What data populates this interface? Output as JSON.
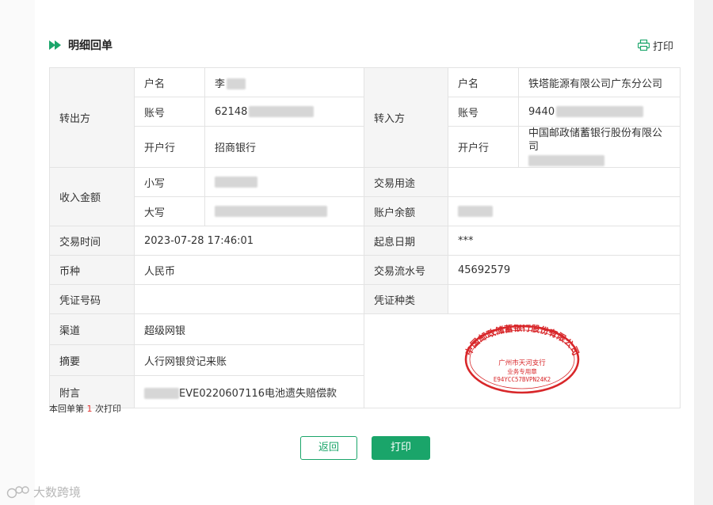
{
  "header": {
    "title": "明细回单",
    "print_label": "打印"
  },
  "payer": {
    "section_label": "转出方",
    "name_label": "户名",
    "name_value": "李",
    "account_label": "账号",
    "account_value": "62148",
    "bank_label": "开户行",
    "bank_value": "招商银行"
  },
  "payee": {
    "section_label": "转入方",
    "name_label": "户名",
    "name_value": "铁塔能源有限公司广东分公司",
    "account_label": "账号",
    "account_value": "9440",
    "bank_label": "开户行",
    "bank_value": "中国邮政储蓄银行股份有限公司"
  },
  "amount": {
    "section_label": "收入金额",
    "lower_label": "小写",
    "upper_label": "大写",
    "purpose_label": "交易用途",
    "balance_label": "账户余额"
  },
  "tx": {
    "time_label": "交易时间",
    "time_value": "2023-07-28 17:46:01",
    "value_date_label": "起息日期",
    "value_date_value": "***",
    "currency_label": "币种",
    "currency_value": "人民币",
    "serial_label": "交易流水号",
    "serial_value": "45692579",
    "voucher_no_label": "凭证号码",
    "voucher_type_label": "凭证种类",
    "channel_label": "渠道",
    "channel_value": "超级网银",
    "summary_label": "摘要",
    "summary_value": "人行网银贷记来账",
    "note_label": "附言",
    "note_value": "EVE0220607116电池遗失赔偿款"
  },
  "stamp": {
    "top_text": "中国邮政储蓄银行股份有限公司",
    "line1": "广州市天河支行",
    "line2": "业务专用章",
    "code": "E94YCC57BVPN24K2",
    "color": "#d8272a"
  },
  "footer": {
    "note_prefix": "本回单第",
    "note_count": "1",
    "note_suffix": "次打印"
  },
  "buttons": {
    "back_label": "返回",
    "print_label": "打印"
  },
  "watermark": {
    "text": "大数跨境"
  },
  "colors": {
    "accent": "#1aa56a",
    "label_bg": "#f5f5f5",
    "border": "#e3e3e3"
  }
}
